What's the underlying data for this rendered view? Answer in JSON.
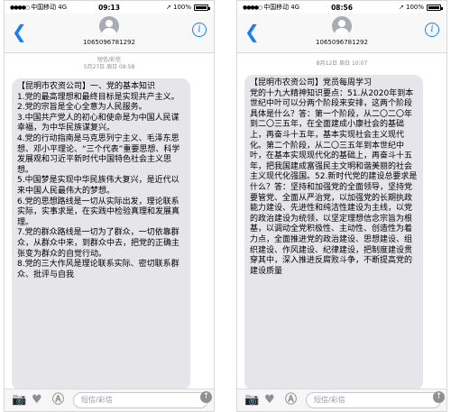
{
  "status_bar": {
    "carrier": "中国移动",
    "network": "4G",
    "battery": "100%"
  },
  "header": {
    "contact": "1065096781292"
  },
  "input_bar": {
    "placeholder": "短信/彩信"
  },
  "screens": [
    {
      "time": "09:13",
      "thread_type": "短信/彩信",
      "date": "5月27日 周日 09:58",
      "message": [
        "【昆明市农资公司】一、党的基本知识",
        "1.党的最高理想和最终目标是实现共产主义。",
        "2.党的宗旨是全心全意为人民服务。",
        "3.中国共产党人的初心和使命是为中国人民谋幸福，为中华民族谋复兴。",
        "4.党的行动指南是马克思列宁主义、毛泽东思想、邓小平理论、“三个代表”重要思想、科学发展观和习近平新时代中国特色社会主义思想。",
        "5.中国梦是实现中华民族伟大复兴，是近代以来中国人民最伟大的梦想。",
        "6.党的思想路线是一切从实际出发，理论联系实际，实事求是，在实践中检验真理和发展真理。",
        "7.党的群众路线是一切为了群众，一切依靠群众，从群众中来，到群众中去，把党的正确主张变为群众的自觉行动。",
        "8.党的三大作风是理论联系实际、密切联系群众、批评与自我"
      ]
    },
    {
      "time": "08:56",
      "thread_type": "",
      "date": "8月12日 周日 10:07",
      "message": [
        "【昆明市农资公司】党员每周学习",
        "党的十九大精神知识要点：51.从2020年到本世纪中叶可以分两个阶段来安排，这两个阶段具体是什么？答：第一个阶段，从二〇二〇年到二〇三五年，在全面建成小康社会的基础上，再奋斗十五年，基本实现社会主义现代化。第二个阶段，从二〇三五年到本世纪中叶，在基本实现现代化的基础上，再奋斗十五年，把我国建成富强民主文明和谐美丽的社会主义现代化强国。52.新时代党的建设总要求是什么？答：坚持和加强党的全面领导，坚持党要管党、全面从严治党，以加强党的长期执政能力建设、先进性和纯洁性建设为主线，以党的政治建设为统领，以坚定理想信念宗旨为根基，以调动全党积极性、主动性、创造性为着力点，全面推进党的政治建设、思想建设、组织建设、作风建设、纪律建设，把制度建设贯穿其中，深入推进反腐败斗争，不断提高党的建设质量"
      ]
    }
  ]
}
